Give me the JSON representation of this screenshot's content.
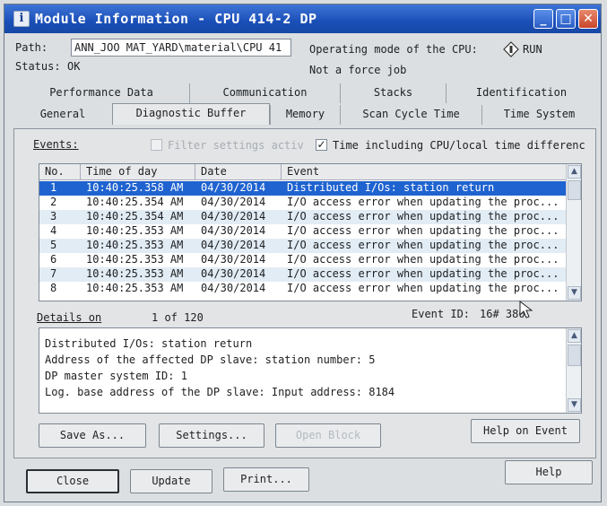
{
  "window": {
    "title": "Module Information - CPU 414-2 DP"
  },
  "header": {
    "path_label": "Path:",
    "path_value": "ANN_JOO MAT_YARD\\material\\CPU 41",
    "status_label": "Status:",
    "status_value": "OK",
    "opmode_label": "Operating mode of the CPU:",
    "opmode_value": "RUN",
    "force_text": "Not a force job"
  },
  "tabs": {
    "row1": [
      "Performance Data",
      "Communication",
      "Stacks",
      "Identification"
    ],
    "row2": [
      "General",
      "Diagnostic Buffer",
      "Memory",
      "Scan Cycle Time",
      "Time System"
    ],
    "active": "Diagnostic Buffer"
  },
  "events": {
    "label": "Events:",
    "filter_label": "Filter settings activ",
    "time_label": "Time including CPU/local time differenc",
    "columns": [
      "No.",
      "Time of day",
      "Date",
      "Event"
    ],
    "rows": [
      {
        "no": "1",
        "time": "10:40:25.358 AM",
        "date": "04/30/2014",
        "event": "Distributed I/Os: station return"
      },
      {
        "no": "2",
        "time": "10:40:25.354 AM",
        "date": "04/30/2014",
        "event": "I/O access error when updating the proc..."
      },
      {
        "no": "3",
        "time": "10:40:25.354 AM",
        "date": "04/30/2014",
        "event": "I/O access error when updating the proc..."
      },
      {
        "no": "4",
        "time": "10:40:25.353 AM",
        "date": "04/30/2014",
        "event": "I/O access error when updating the proc..."
      },
      {
        "no": "5",
        "time": "10:40:25.353 AM",
        "date": "04/30/2014",
        "event": "I/O access error when updating the proc..."
      },
      {
        "no": "6",
        "time": "10:40:25.353 AM",
        "date": "04/30/2014",
        "event": "I/O access error when updating the proc..."
      },
      {
        "no": "7",
        "time": "10:40:25.353 AM",
        "date": "04/30/2014",
        "event": "I/O access error when updating the proc..."
      },
      {
        "no": "8",
        "time": "10:40:25.353 AM",
        "date": "04/30/2014",
        "event": "I/O access error when updating the proc..."
      }
    ]
  },
  "details": {
    "label": "Details on",
    "counter": "1 of 120",
    "event_id_label": "Event ID:",
    "event_id_value": "16# 380",
    "lines": [
      "Distributed I/Os: station return",
      "Address of the affected DP slave: station number:   5",
      "DP master system ID:   1",
      "Log. base address of the DP slave: Input address: 8184"
    ]
  },
  "buttons": {
    "save_as": "Save As...",
    "settings": "Settings...",
    "open_block": "Open Block",
    "help_on_event": "Help on Event",
    "close": "Close",
    "update": "Update",
    "print": "Print...",
    "help": "Help"
  },
  "colors": {
    "title_bar": "#1a4fb8",
    "selection": "#1f63d0",
    "alt_row": "#e2ecf4"
  }
}
